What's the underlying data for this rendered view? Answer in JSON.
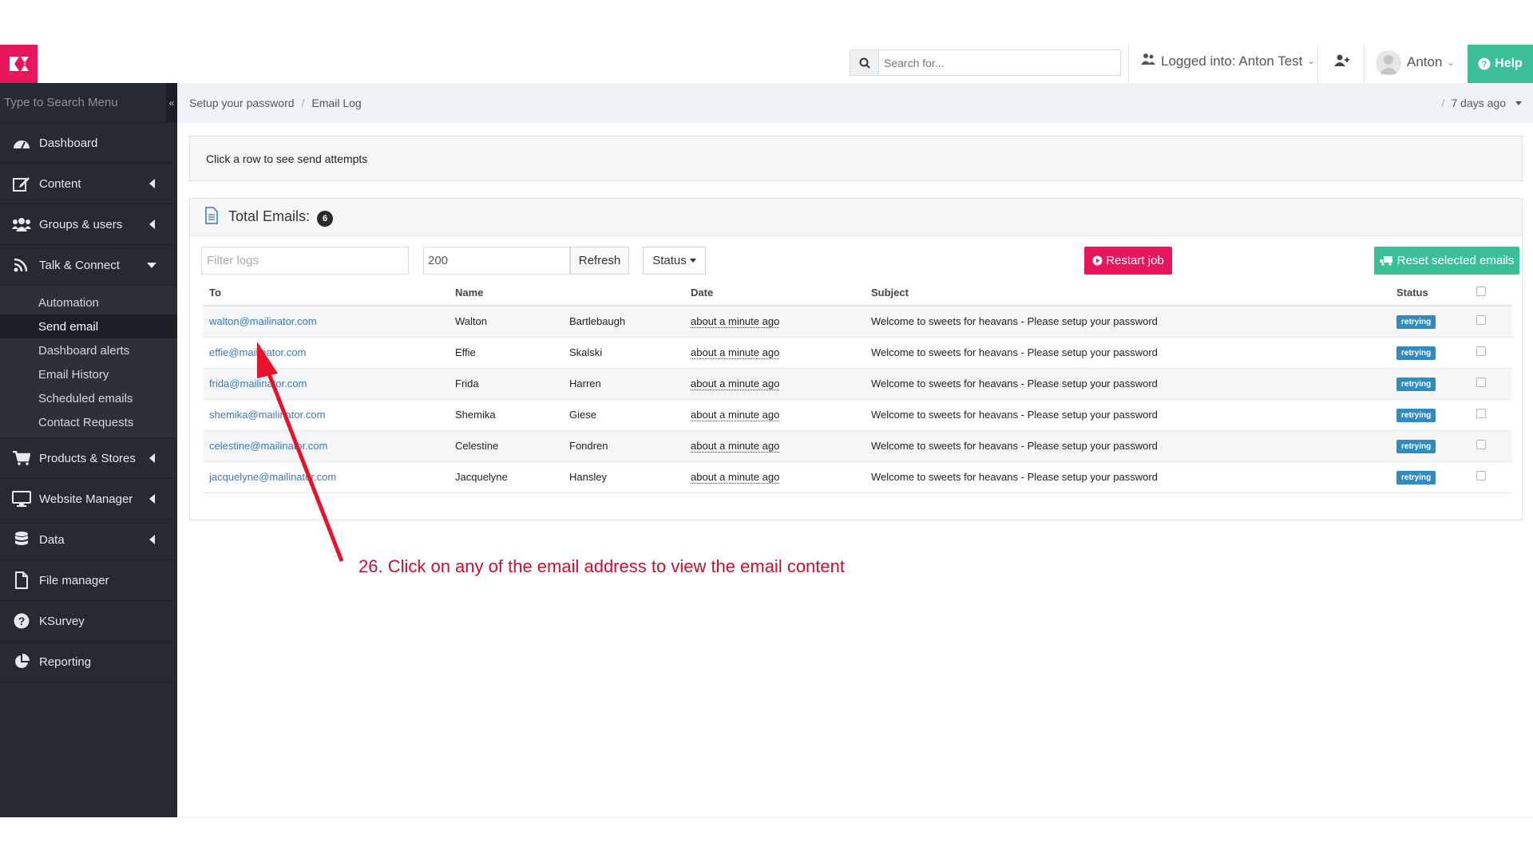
{
  "app": {
    "search_placeholder": "Search for...",
    "logged_into": "Logged into: Anton Test",
    "user_name": "Anton",
    "help_label": "Help"
  },
  "sidebar": {
    "search_placeholder": "Type to Search Menu",
    "items": [
      {
        "label": "Dashboard",
        "icon": "dashboard-icon"
      },
      {
        "label": "Content",
        "icon": "edit-icon"
      },
      {
        "label": "Groups & users",
        "icon": "users-icon"
      },
      {
        "label": "Talk & Connect",
        "icon": "rss-icon"
      },
      {
        "label": "Products & Stores",
        "icon": "cart-icon"
      },
      {
        "label": "Website Manager",
        "icon": "monitor-icon"
      },
      {
        "label": "Data",
        "icon": "database-icon"
      },
      {
        "label": "File manager",
        "icon": "file-icon"
      },
      {
        "label": "KSurvey",
        "icon": "question-icon"
      },
      {
        "label": "Reporting",
        "icon": "pie-chart-icon"
      }
    ],
    "submenu": [
      "Automation",
      "Send email",
      "Dashboard alerts",
      "Email History",
      "Scheduled emails",
      "Contact Requests"
    ],
    "active_sub": "Send email"
  },
  "breadcrumb": {
    "items": [
      "Setup your password",
      "Email Log"
    ],
    "time_sep": "/",
    "time_range": "7 days ago"
  },
  "info": "Click a row to see send attempts",
  "panel": {
    "title": "Total Emails:",
    "count": "6",
    "filter_placeholder": "Filter logs",
    "limit_value": "200",
    "refresh_label": "Refresh",
    "status_label": "Status",
    "restart_label": "Restart job",
    "reset_label": "Reset selected emails"
  },
  "table": {
    "headers": [
      "To",
      "Name",
      "",
      "Date",
      "Subject",
      "Status"
    ],
    "rows": [
      {
        "to": "walton@mailinator.com",
        "first": "Walton",
        "last": "Bartlebaugh",
        "date": "about a minute ago",
        "subject": "Welcome to sweets for heavans - Please setup your password",
        "status": "retrying"
      },
      {
        "to": "effie@mailinator.com",
        "first": "Effie",
        "last": "Skalski",
        "date": "about a minute ago",
        "subject": "Welcome to sweets for heavans - Please setup your password",
        "status": "retrying"
      },
      {
        "to": "frida@mailinator.com",
        "first": "Frida",
        "last": "Harren",
        "date": "about a minute ago",
        "subject": "Welcome to sweets for heavans - Please setup your password",
        "status": "retrying"
      },
      {
        "to": "shemika@mailinator.com",
        "first": "Shemika",
        "last": "Giese",
        "date": "about a minute ago",
        "subject": "Welcome to sweets for heavans - Please setup your password",
        "status": "retrying"
      },
      {
        "to": "celestine@mailinator.com",
        "first": "Celestine",
        "last": "Fondren",
        "date": "about a minute ago",
        "subject": "Welcome to sweets for heavans - Please setup your password",
        "status": "retrying"
      },
      {
        "to": "jacquelyne@mailinator.com",
        "first": "Jacquelyne",
        "last": "Hansley",
        "date": "about a minute ago",
        "subject": "Welcome to sweets for heavans - Please setup your password",
        "status": "retrying"
      }
    ]
  },
  "annotation": "26. Click on any of the email address to view the email content",
  "colors": {
    "brand": "#e8175d",
    "success": "#3bbf97",
    "sidebar": "#252a33",
    "annotation": "#c8102e"
  }
}
